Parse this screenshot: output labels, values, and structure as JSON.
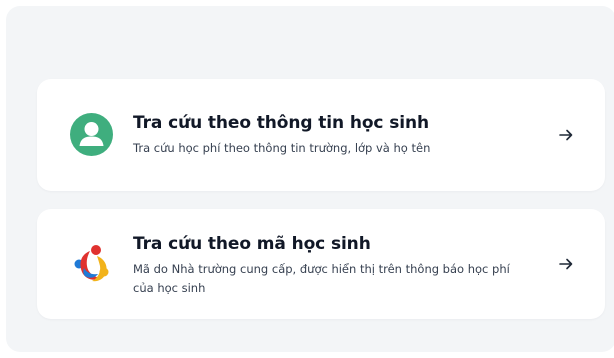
{
  "lookup_options": [
    {
      "title": "Tra cứu theo thông tin học sinh",
      "description": "Tra cứu học phí theo thông tin trường, lớp và họ tên",
      "icon": "student-profile-icon",
      "arrow_icon": "arrow-right-icon"
    },
    {
      "title": "Tra cứu theo mã học sinh",
      "description": "Mã do Nhà trường cung cấp, được hiển thị trên thông báo học phí của học sinh",
      "icon": "school-code-logo-icon",
      "arrow_icon": "arrow-right-icon"
    }
  ],
  "colors": {
    "panel_background": "#f3f5f7",
    "card_background": "#ffffff",
    "profile_icon_green": "#3fae7e",
    "title_text": "#111827",
    "description_text": "#374151",
    "arrow": "#1f2937"
  }
}
